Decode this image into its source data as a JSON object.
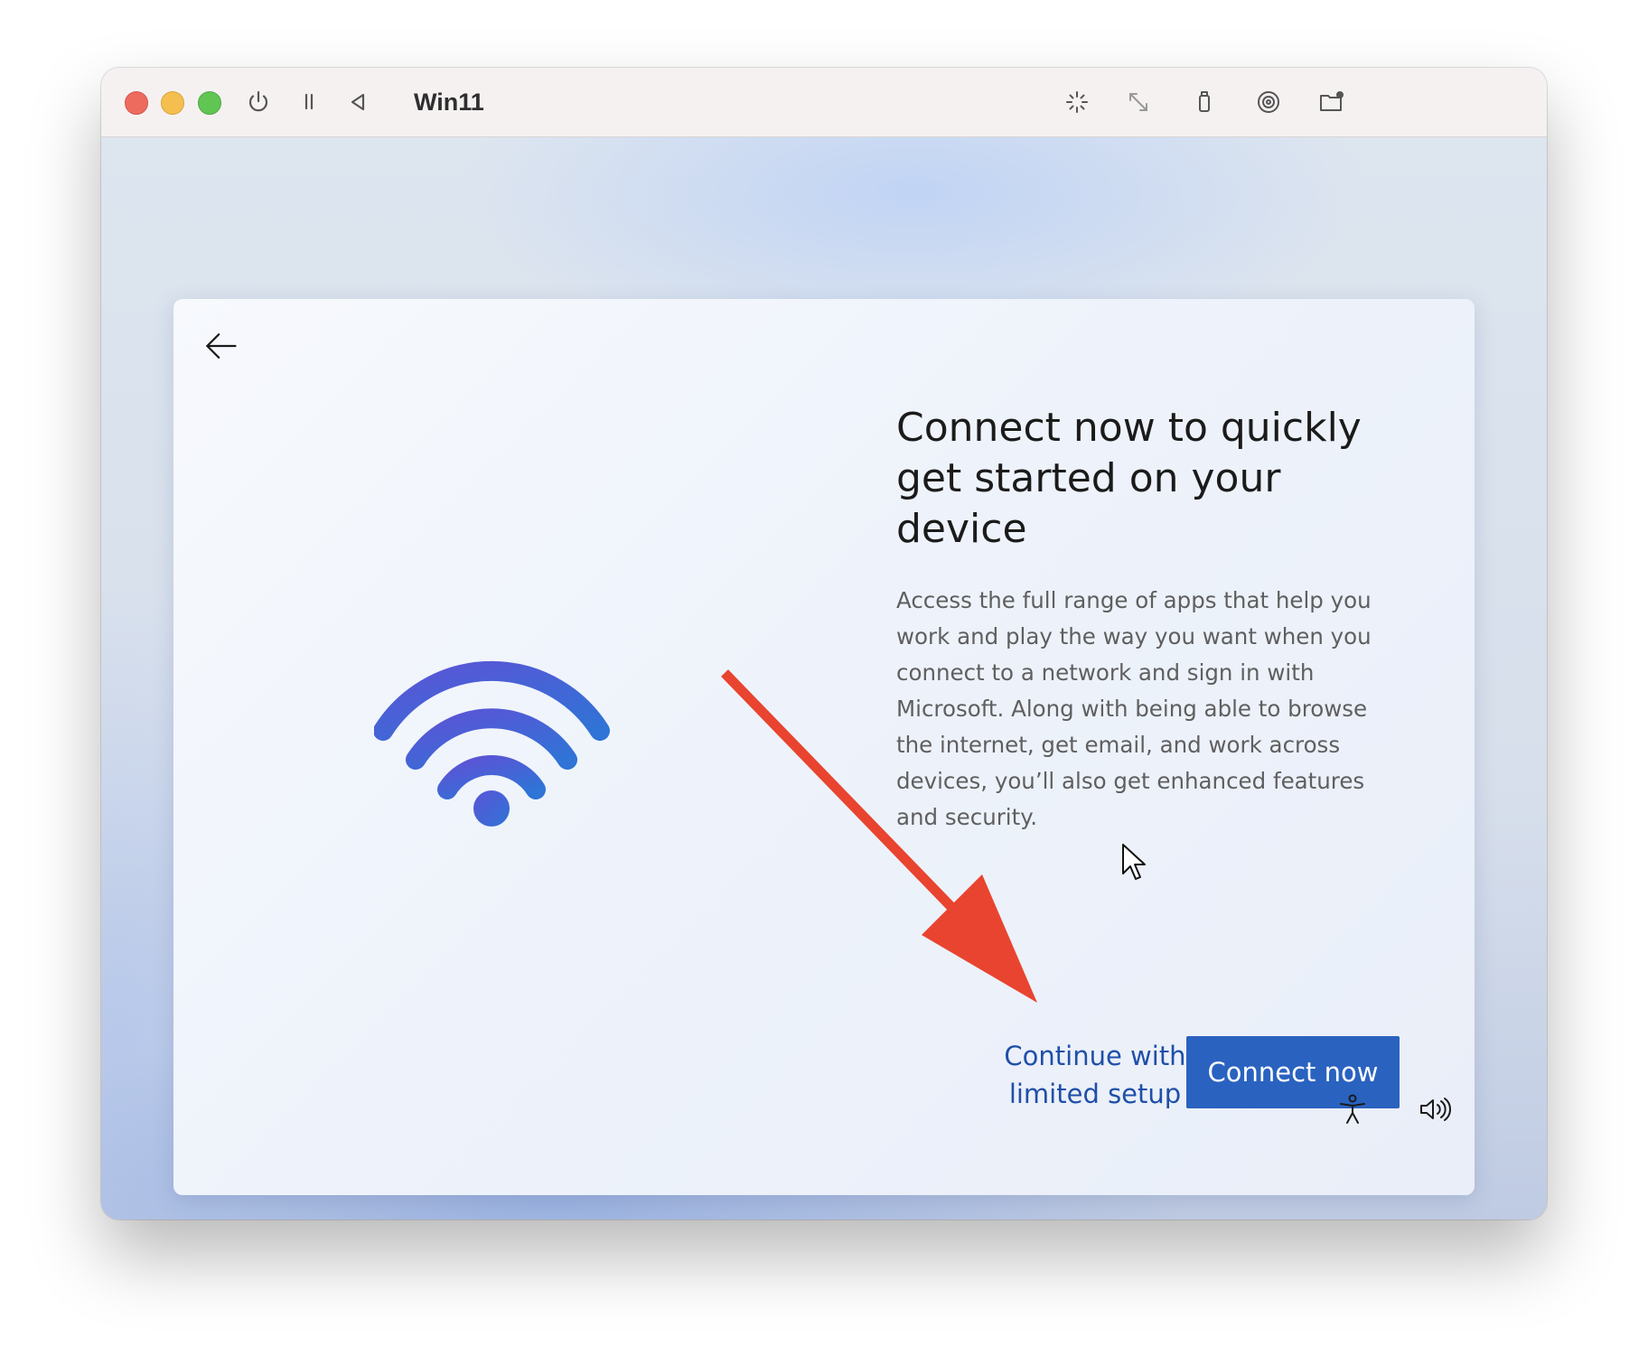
{
  "window": {
    "title": "Win11",
    "controls": [
      "close",
      "minimize",
      "zoom"
    ]
  },
  "toolbar": {
    "left_icons": [
      "power-icon",
      "pause-icon",
      "back-triangle-icon"
    ],
    "right_icons": [
      "brightness-icon",
      "resize-icon",
      "usb-icon",
      "disc-icon",
      "shared-folder-icon"
    ]
  },
  "setup": {
    "headline": "Connect now to quickly get started on your device",
    "body": "Access the full range of apps that help you work and play the way you want when you connect to a network and sign in with Microsoft. Along with being able to browse the internet, get email, and work across devices, you’ll also get enhanced features and security.",
    "limited_setup_label": "Continue with limited setup",
    "connect_label": "Connect now",
    "illustration": "wifi-icon"
  },
  "annotation": {
    "arrow_color": "#e8442f",
    "points_to": "limited-setup-link"
  },
  "taskbar": {
    "icons": [
      "accessibility-icon",
      "volume-icon"
    ]
  },
  "colors": {
    "accent": "#2a62c0",
    "link": "#1f4fa8",
    "wifi_gradient_start": "#5b54d6",
    "wifi_gradient_end": "#2f74d6"
  }
}
